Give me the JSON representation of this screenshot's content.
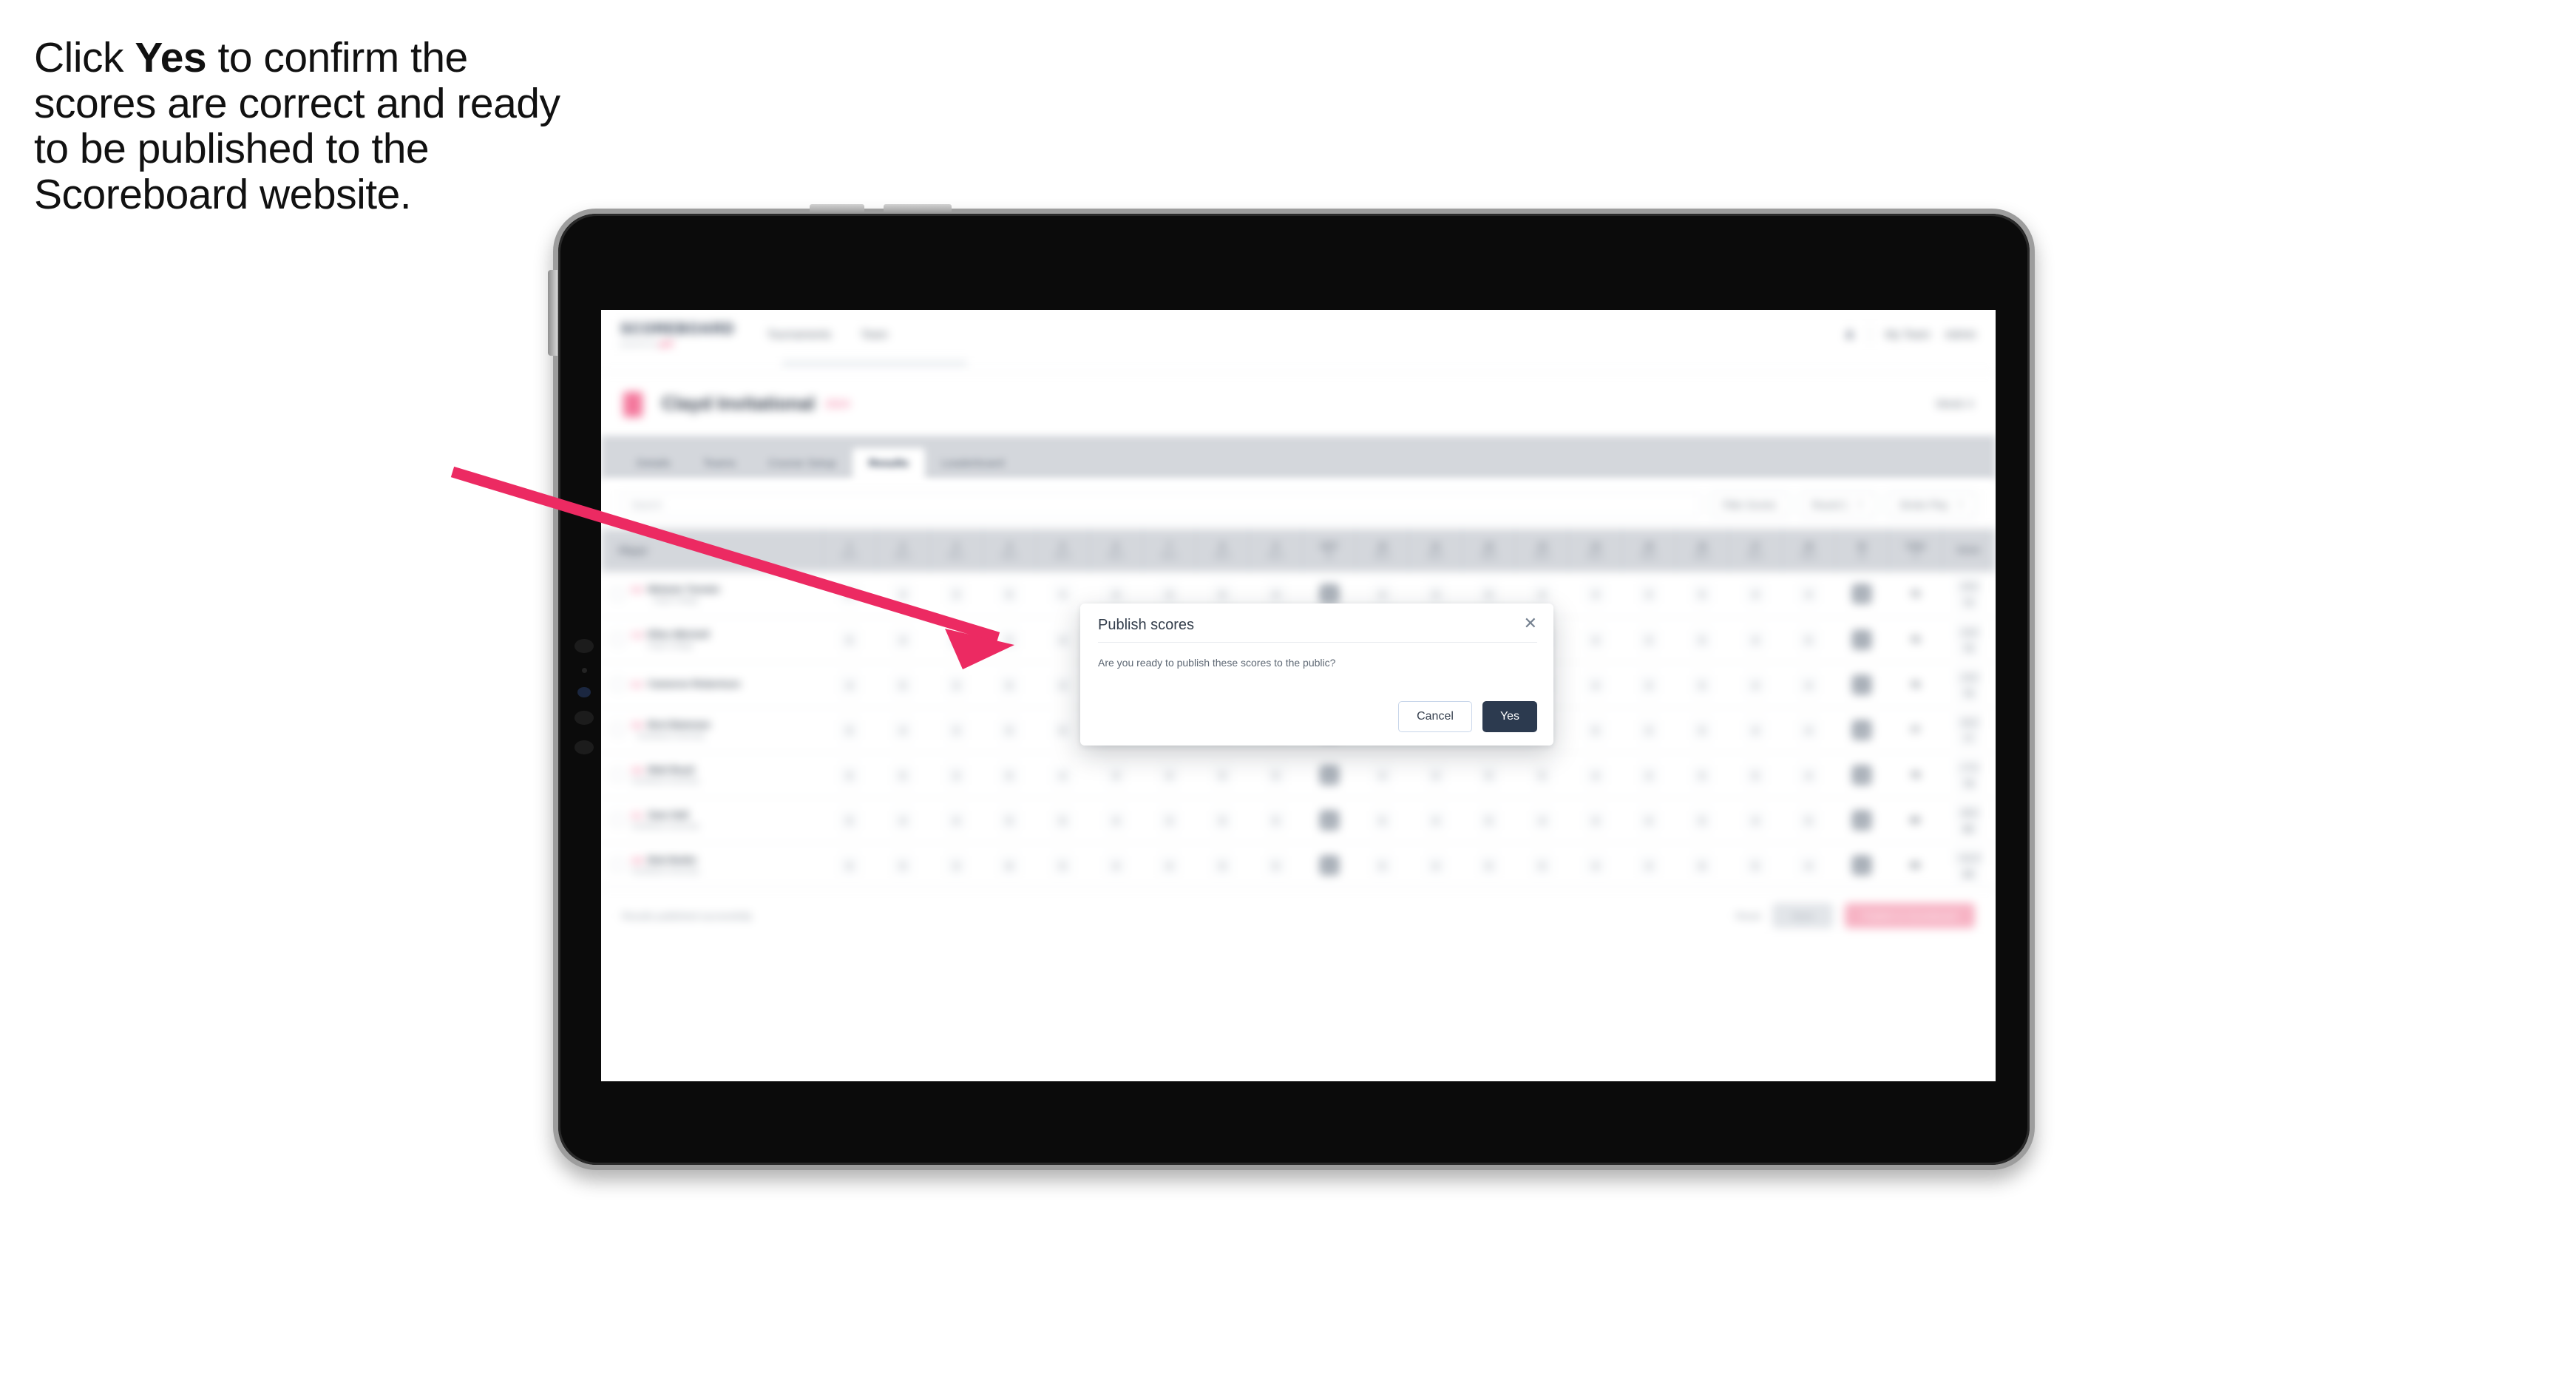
{
  "caption": {
    "before": "Click ",
    "emphasis": "Yes",
    "after": " to confirm the scores are correct and ready to be published to the Scoreboard website."
  },
  "colors": {
    "arrow": "#ec2a62",
    "accent_pink": "#ec2a62",
    "primary_dark": "#2c3a4f",
    "tabbar_grey": "#d4d7dc",
    "publish_button_pink": "#f7b3c4"
  },
  "app": {
    "brand": {
      "word": "SCOREBOARD",
      "sub_prefix": "powered by",
      "sub_accent": "golf"
    },
    "nav": {
      "items": [
        "Tournaments",
        "Team"
      ],
      "right_items": [
        "My Team",
        "Admin"
      ],
      "bell_icon": "bell-icon"
    },
    "tournament": {
      "name": "Clayd Invitational",
      "meta": "2024",
      "right_label": "Week 4",
      "flag_icon": "flag-icon"
    },
    "tabs": [
      {
        "label": "Details",
        "active": false
      },
      {
        "label": "Teams",
        "active": false
      },
      {
        "label": "Course Setup",
        "active": false
      },
      {
        "label": "Results",
        "active": true
      },
      {
        "label": "Leaderboard",
        "active": false
      }
    ],
    "filters": {
      "search_placeholder": "Search",
      "filter_label": "Filter Scores",
      "round_label": "Round 1",
      "round_caret": "chevron-down-icon",
      "view_label": "Stroke Play",
      "view_caret": "chevron-down-icon"
    },
    "table": {
      "player_header": "Player",
      "holes": [
        {
          "no": "1",
          "par": "Par 4"
        },
        {
          "no": "2",
          "par": "Par 4"
        },
        {
          "no": "3",
          "par": "Par 3"
        },
        {
          "no": "4",
          "par": "Par 5"
        },
        {
          "no": "5",
          "par": "Par 4"
        },
        {
          "no": "6",
          "par": "Par 4"
        },
        {
          "no": "7",
          "par": "Par 3"
        },
        {
          "no": "8",
          "par": "Par 5"
        },
        {
          "no": "9",
          "par": "Par 4"
        },
        {
          "no": "OUT",
          "par": "36"
        },
        {
          "no": "10",
          "par": "Par 4"
        },
        {
          "no": "11",
          "par": "Par 3"
        },
        {
          "no": "12",
          "par": "Par 5"
        },
        {
          "no": "13",
          "par": "Par 4"
        },
        {
          "no": "14",
          "par": "Par 4"
        },
        {
          "no": "15",
          "par": "Par 3"
        },
        {
          "no": "16",
          "par": "Par 5"
        },
        {
          "no": "17",
          "par": "Par 4"
        },
        {
          "no": "18",
          "par": "Par 4"
        }
      ],
      "tail_headers": [
        {
          "no": "IN",
          "par": "36"
        },
        {
          "no": "Total",
          "par": "72"
        },
        {
          "no": "Score",
          "par": ""
        }
      ],
      "rows": [
        {
          "hcp": "0.2",
          "name": "Melanie Tomato",
          "club": "Clayd College",
          "scores": [
            "4",
            "4",
            "3",
            "5",
            "4",
            "4",
            "3",
            "5",
            "4"
          ],
          "out": "36",
          "scores_in": [
            "4",
            "3",
            "5",
            "4",
            "4",
            "3",
            "5",
            "4",
            "4"
          ],
          "in": "36",
          "total": "72",
          "pair": [
            "+0.0",
            "72"
          ]
        },
        {
          "hcp": "1.4",
          "name": "Ellen Mitchell",
          "club": "Clayd College",
          "scores": [
            "5",
            "4",
            "3",
            "5",
            "4",
            "5",
            "3",
            "5",
            "4"
          ],
          "out": "38",
          "scores_in": [
            "4",
            "3",
            "5",
            "4",
            "4",
            "3",
            "5",
            "4",
            "5"
          ],
          "in": "37",
          "total": "75",
          "pair": [
            "+3.0",
            "75"
          ]
        },
        {
          "hcp": "2.1",
          "name": "Cameron Robertson",
          "club": "",
          "scores": [
            "4",
            "5",
            "3",
            "5",
            "4",
            "4",
            "4",
            "5",
            "4"
          ],
          "out": "38",
          "scores_in": [
            "5",
            "3",
            "5",
            "4",
            "4",
            "3",
            "5",
            "4",
            "4"
          ],
          "in": "37",
          "total": "75",
          "pair": [
            "+3.0",
            "75"
          ]
        },
        {
          "hcp": "3.0",
          "name": "Bret Bateman",
          "club": "Southland University",
          "scores": [
            "5",
            "4",
            "3",
            "5",
            "5",
            "4",
            "3",
            "5",
            "5"
          ],
          "out": "39",
          "scores_in": [
            "4",
            "4",
            "5",
            "4",
            "5",
            "3",
            "5",
            "4",
            "4"
          ],
          "in": "38",
          "total": "77",
          "pair": [
            "+5.0",
            "77"
          ]
        },
        {
          "hcp": "3.6",
          "name": "Matt Boyd",
          "club": "Southland University",
          "scores": [
            "5",
            "5",
            "3",
            "5",
            "4",
            "4",
            "4",
            "5",
            "5"
          ],
          "out": "40",
          "scores_in": [
            "4",
            "4",
            "5",
            "5",
            "4",
            "3",
            "5",
            "5",
            "4"
          ],
          "in": "39",
          "total": "79",
          "pair": [
            "+7.0",
            "79"
          ]
        },
        {
          "hcp": "4.1",
          "name": "Sam Hall",
          "club": "Southland University",
          "scores": [
            "5",
            "4",
            "4",
            "5",
            "5",
            "4",
            "3",
            "5",
            "5"
          ],
          "out": "40",
          "scores_in": [
            "5",
            "4",
            "5",
            "4",
            "4",
            "4",
            "5",
            "4",
            "5"
          ],
          "in": "40",
          "total": "80",
          "pair": [
            "+8.0",
            "80"
          ]
        },
        {
          "hcp": "4.8",
          "name": "Bob Butler",
          "club": "Southland University",
          "scores": [
            "5",
            "5",
            "3",
            "6",
            "5",
            "4",
            "4",
            "5",
            "5"
          ],
          "out": "42",
          "scores_in": [
            "5",
            "4",
            "5",
            "5",
            "4",
            "3",
            "6",
            "5",
            "4"
          ],
          "in": "41",
          "total": "83",
          "pair": [
            "+11.0",
            "83"
          ]
        }
      ]
    },
    "footer": {
      "note": "Results published successfully",
      "link_label": "Reset",
      "secondary_button": "Save",
      "primary_button": "Publish to Scoreboard"
    }
  },
  "modal": {
    "title": "Publish scores",
    "close_icon": "close-icon",
    "body": "Are you ready to publish these scores to the public?",
    "cancel_label": "Cancel",
    "yes_label": "Yes"
  }
}
